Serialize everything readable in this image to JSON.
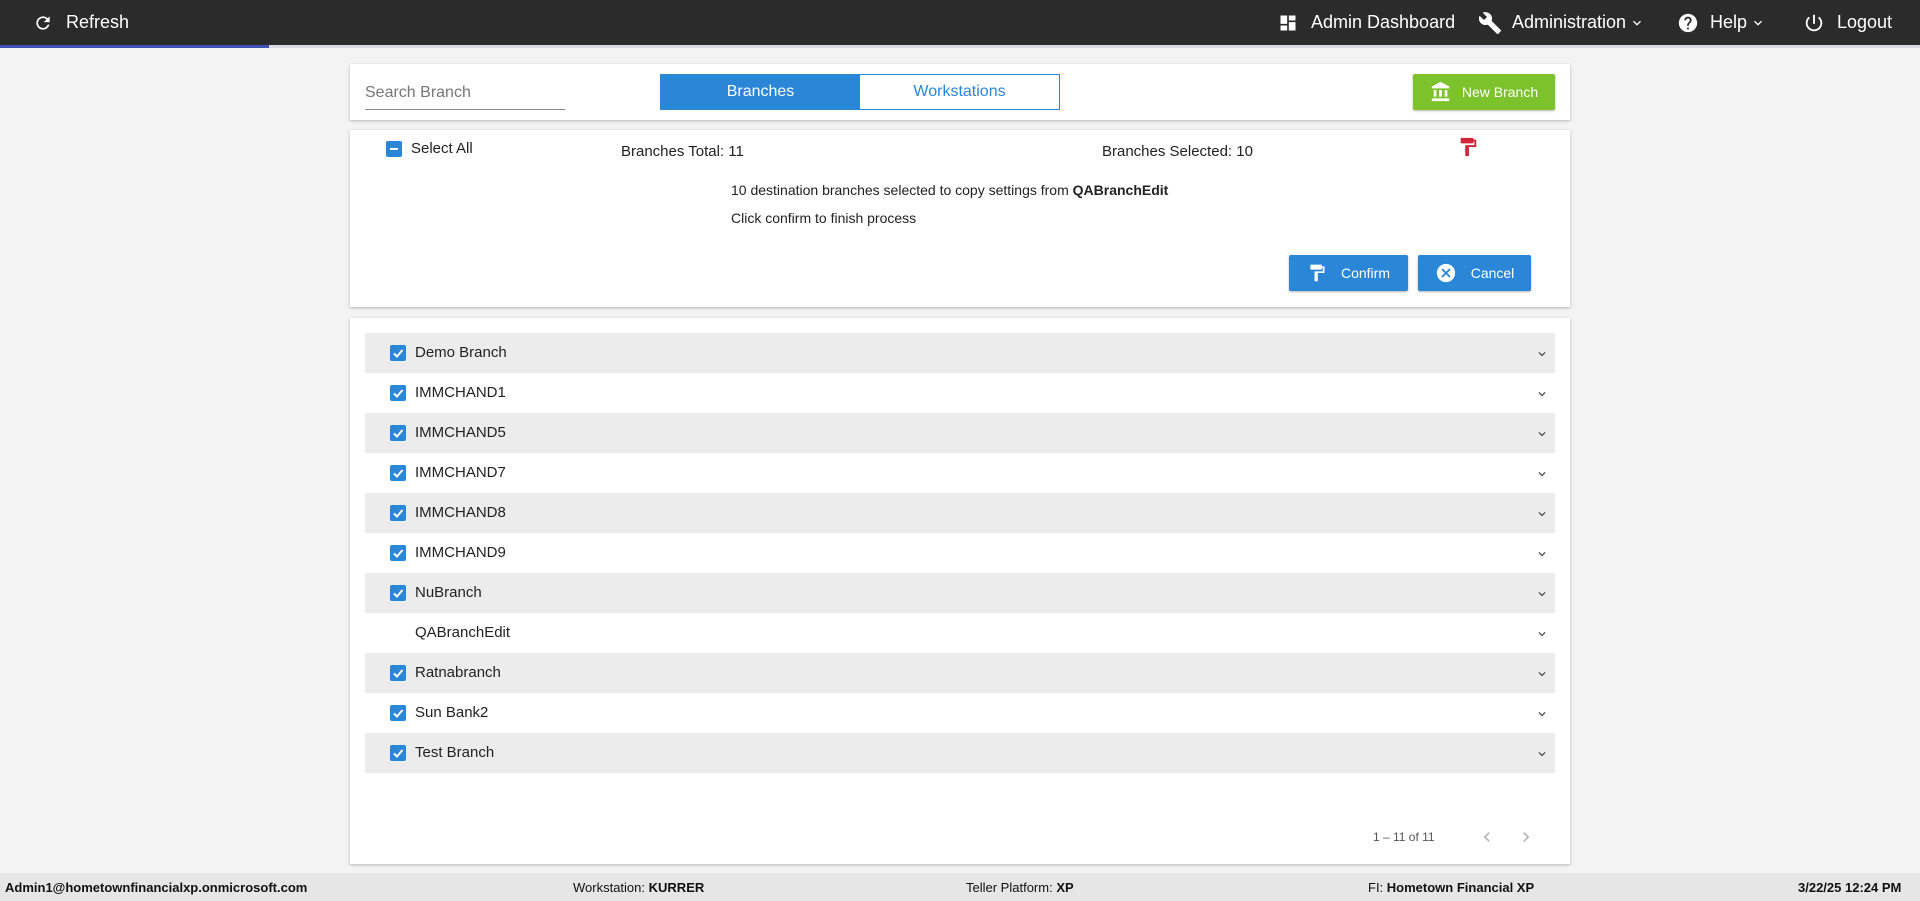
{
  "header": {
    "refresh_label": "Refresh",
    "admin_dashboard_label": "Admin Dashboard",
    "administration_label": "Administration",
    "help_label": "Help",
    "logout_label": "Logout",
    "load_progress": 0.14
  },
  "toolbar": {
    "search_placeholder": "Search Branch",
    "tabs": [
      {
        "label": "Branches",
        "active": true
      },
      {
        "label": "Workstations",
        "active": false
      }
    ],
    "new_branch_label": "New Branch"
  },
  "copy_panel": {
    "select_all_label": "Select All",
    "branches_total": "Branches Total: 11",
    "branches_selected": "Branches Selected: 10",
    "message_prefix": "10 destination branches selected to copy settings from",
    "source_branch": "QABranchEdit",
    "message_line2": "Click confirm to finish process",
    "confirm_label": "Confirm",
    "cancel_label": "Cancel"
  },
  "branches": [
    {
      "name": "Demo Branch",
      "checked": true
    },
    {
      "name": "IMMCHAND1",
      "checked": true
    },
    {
      "name": "IMMCHAND5",
      "checked": true
    },
    {
      "name": "IMMCHAND7",
      "checked": true
    },
    {
      "name": "IMMCHAND8",
      "checked": true
    },
    {
      "name": "IMMCHAND9",
      "checked": true
    },
    {
      "name": "NuBranch",
      "checked": true
    },
    {
      "name": "QABranchEdit",
      "checked": false
    },
    {
      "name": "Ratnabranch",
      "checked": true
    },
    {
      "name": "Sun Bank2",
      "checked": true
    },
    {
      "name": "Test Branch",
      "checked": true
    }
  ],
  "paginator": {
    "range_label": "1 – 11 of 11"
  },
  "status_bar": {
    "user": "Admin1@hometownfinancialxp.onmicrosoft.com",
    "workstation_label": "Workstation:",
    "workstation_value": "KURRER",
    "platform_label": "Teller Platform:",
    "platform_value": "XP",
    "fi_label": "FI:",
    "fi_value": "Hometown Financial XP",
    "datetime": "3/22/25 12:24 PM"
  },
  "colors": {
    "topbar": "#2b2b2b",
    "primary": "#2a87d8",
    "new_branch": "#7cc32b",
    "paint_icon": "#d0253a"
  }
}
